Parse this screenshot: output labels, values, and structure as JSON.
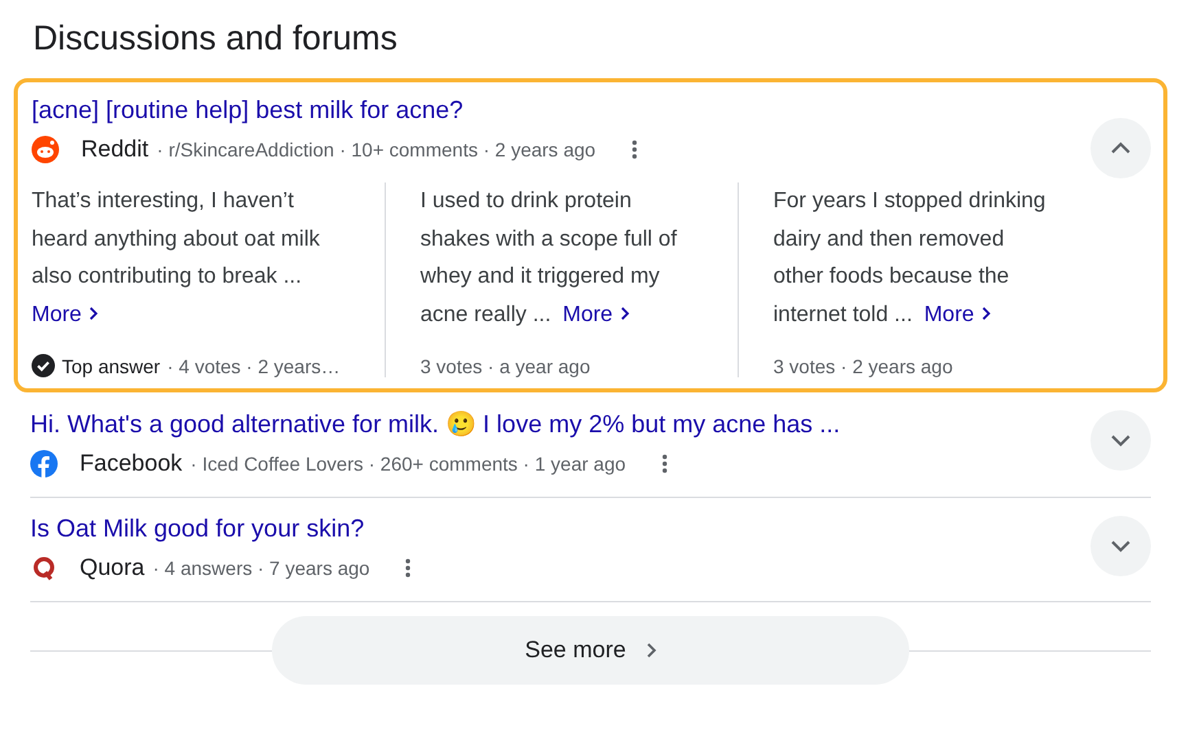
{
  "heading": "Discussions and forums",
  "threads": [
    {
      "title": "[acne] [routine help] best milk for acne?",
      "kind": "reddit",
      "source": "Reddit",
      "details": "· r/SkincareAddiction · 10+ comments · 2 years ago",
      "expanded": true,
      "answers": [
        {
          "text": "That’s interesting, I haven’t heard anything about oat milk also contributing to break ...",
          "more": "More",
          "top_answer": true,
          "badge": "Top answer",
          "meta": "· 4 votes · 2 years…"
        },
        {
          "text": "I used to drink protein shakes with a scope full of whey and it triggered my acne really ...",
          "more": "More",
          "top_answer": false,
          "meta": "3 votes · a year ago"
        },
        {
          "text": "For years I stopped drinking dairy and then removed other foods because the internet told ...",
          "more": "More",
          "top_answer": false,
          "meta": "3 votes · 2 years ago"
        }
      ]
    },
    {
      "title": "Hi. What's a good alternative for milk. 🥲 I love my 2% but my acne has ...",
      "kind": "facebook",
      "source": "Facebook",
      "details": "· Iced Coffee Lovers · 260+ comments · 1 year ago",
      "expanded": false
    },
    {
      "title": "Is Oat Milk good for your skin?",
      "kind": "quora",
      "source": "Quora",
      "details": "· 4 answers · 7 years ago",
      "expanded": false
    }
  ],
  "see_more": "See more"
}
